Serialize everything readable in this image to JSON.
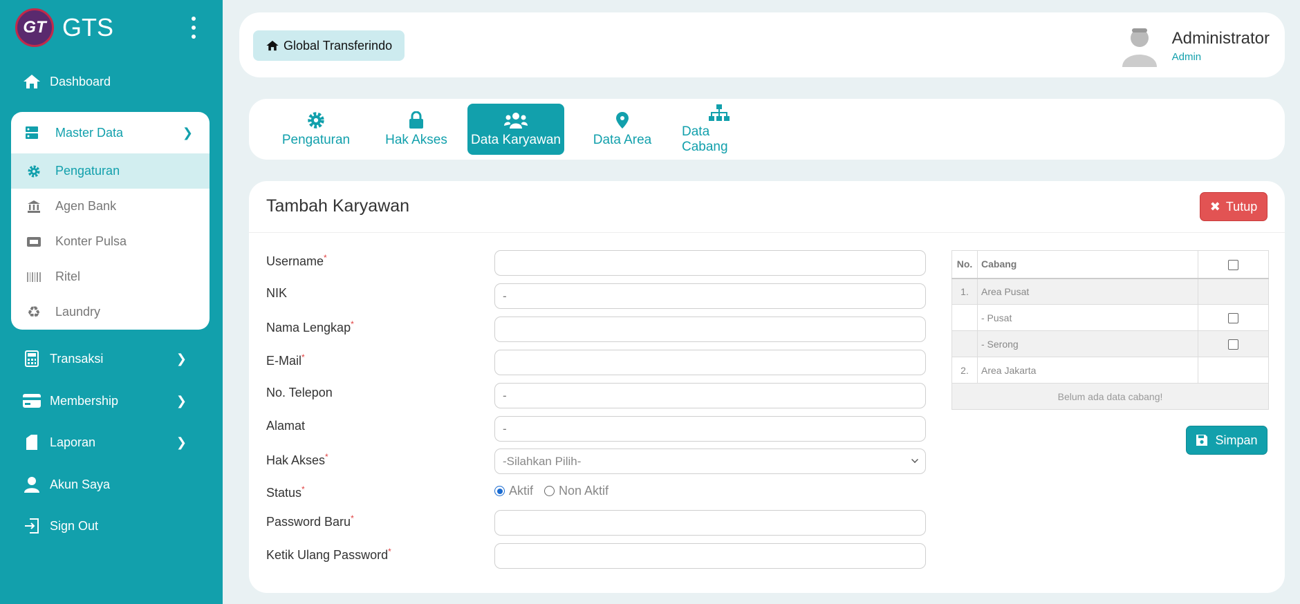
{
  "brand": {
    "logo_text": "GT",
    "name": "GTS"
  },
  "sidebar": {
    "dashboard": "Dashboard",
    "master_data": {
      "label": "Master Data",
      "items": [
        "Pengaturan",
        "Agen Bank",
        "Konter Pulsa",
        "Ritel",
        "Laundry"
      ]
    },
    "transaksi": "Transaksi",
    "membership": "Membership",
    "laporan": "Laporan",
    "akun_saya": "Akun Saya",
    "sign_out": "Sign Out"
  },
  "header": {
    "breadcrumb": "Global Transferindo",
    "user_name": "Administrator",
    "user_role": "Admin"
  },
  "tabs": [
    "Pengaturan",
    "Hak Akses",
    "Data Karyawan",
    "Data Area",
    "Data Cabang"
  ],
  "form": {
    "title": "Tambah Karyawan",
    "close_label": "Tutup",
    "save_label": "Simpan",
    "fields": {
      "username": {
        "label": "Username",
        "value": ""
      },
      "nik": {
        "label": "NIK",
        "value": "-"
      },
      "nama_lengkap": {
        "label": "Nama Lengkap",
        "value": ""
      },
      "email": {
        "label": "E-Mail",
        "value": ""
      },
      "telepon": {
        "label": "No. Telepon",
        "value": "-"
      },
      "alamat": {
        "label": "Alamat",
        "value": "-"
      },
      "hak_akses": {
        "label": "Hak Akses",
        "value": "-Silahkan Pilih-"
      },
      "status": {
        "label": "Status",
        "options": [
          "Aktif",
          "Non Aktif"
        ]
      },
      "password_baru": {
        "label": "Password Baru",
        "value": ""
      },
      "ketik_ulang": {
        "label": "Ketik Ulang Password",
        "value": ""
      }
    },
    "required_mark": "*"
  },
  "branch_table": {
    "headers": [
      "No.",
      "Cabang"
    ],
    "rows": [
      {
        "no": "1.",
        "name": "Area Pusat"
      },
      {
        "no": "",
        "name": "- Pusat"
      },
      {
        "no": "",
        "name": "- Serong"
      },
      {
        "no": "2.",
        "name": "Area Jakarta"
      }
    ],
    "empty_message": "Belum ada data cabang!"
  },
  "colors": {
    "primary": "#12a0ac",
    "danger": "#e25353",
    "background": "#e9f1f3"
  }
}
